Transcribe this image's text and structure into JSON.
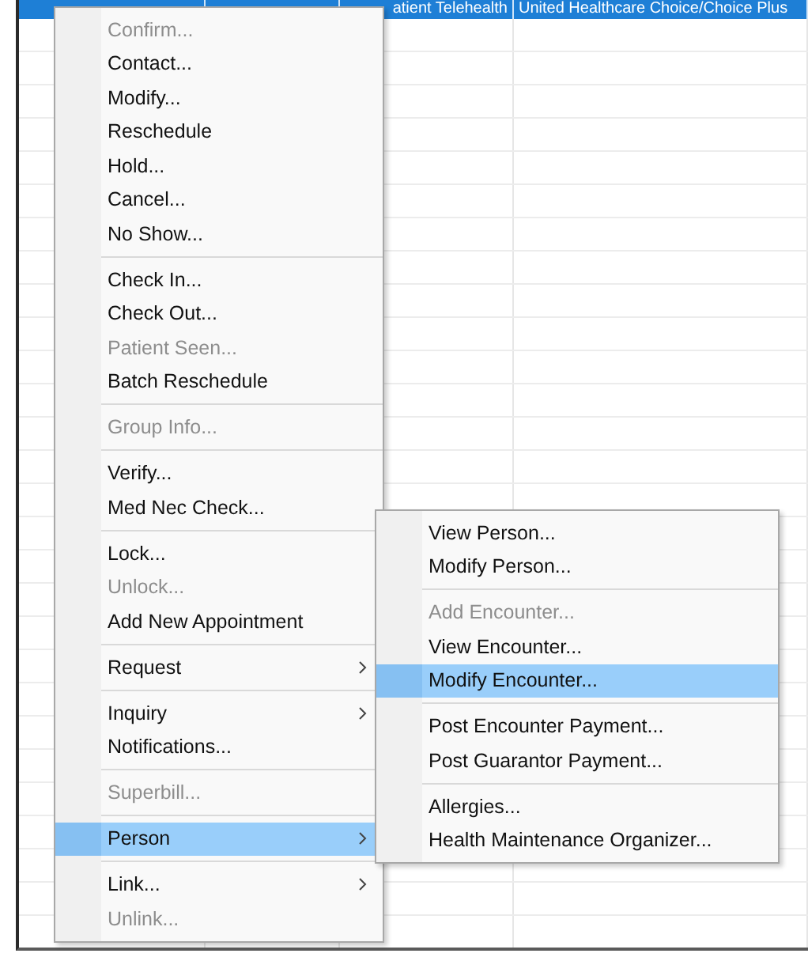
{
  "grid": {
    "selected_row": {
      "cells": [
        "atient Telehealth",
        "United Healthcare Choice/Choice Plus"
      ]
    }
  },
  "context_menu": {
    "groups": [
      [
        {
          "label": "Confirm...",
          "disabled": true,
          "selected": false,
          "has_submenu": false
        },
        {
          "label": "Contact...",
          "disabled": false,
          "selected": false,
          "has_submenu": false
        },
        {
          "label": "Modify...",
          "disabled": false,
          "selected": false,
          "has_submenu": false
        },
        {
          "label": "Reschedule",
          "disabled": false,
          "selected": false,
          "has_submenu": false
        },
        {
          "label": "Hold...",
          "disabled": false,
          "selected": false,
          "has_submenu": false
        },
        {
          "label": "Cancel...",
          "disabled": false,
          "selected": false,
          "has_submenu": false
        },
        {
          "label": "No Show...",
          "disabled": false,
          "selected": false,
          "has_submenu": false
        }
      ],
      [
        {
          "label": "Check In...",
          "disabled": false,
          "selected": false,
          "has_submenu": false
        },
        {
          "label": "Check Out...",
          "disabled": false,
          "selected": false,
          "has_submenu": false
        },
        {
          "label": "Patient Seen...",
          "disabled": true,
          "selected": false,
          "has_submenu": false
        },
        {
          "label": "Batch Reschedule",
          "disabled": false,
          "selected": false,
          "has_submenu": false
        }
      ],
      [
        {
          "label": "Group Info...",
          "disabled": true,
          "selected": false,
          "has_submenu": false
        }
      ],
      [
        {
          "label": "Verify...",
          "disabled": false,
          "selected": false,
          "has_submenu": false
        },
        {
          "label": "Med Nec Check...",
          "disabled": false,
          "selected": false,
          "has_submenu": false
        }
      ],
      [
        {
          "label": "Lock...",
          "disabled": false,
          "selected": false,
          "has_submenu": false
        },
        {
          "label": "Unlock...",
          "disabled": true,
          "selected": false,
          "has_submenu": false
        },
        {
          "label": "Add New Appointment",
          "disabled": false,
          "selected": false,
          "has_submenu": false
        }
      ],
      [
        {
          "label": "Request",
          "disabled": false,
          "selected": false,
          "has_submenu": true
        }
      ],
      [
        {
          "label": "Inquiry",
          "disabled": false,
          "selected": false,
          "has_submenu": true
        },
        {
          "label": "Notifications...",
          "disabled": false,
          "selected": false,
          "has_submenu": false
        }
      ],
      [
        {
          "label": "Superbill...",
          "disabled": true,
          "selected": false,
          "has_submenu": false
        }
      ],
      [
        {
          "label": "Person",
          "disabled": false,
          "selected": true,
          "has_submenu": true
        }
      ],
      [
        {
          "label": "Link...",
          "disabled": false,
          "selected": false,
          "has_submenu": true
        },
        {
          "label": "Unlink...",
          "disabled": true,
          "selected": false,
          "has_submenu": false
        }
      ]
    ]
  },
  "submenu": {
    "groups": [
      [
        {
          "label": "View Person...",
          "disabled": false,
          "selected": false,
          "has_submenu": false
        },
        {
          "label": "Modify Person...",
          "disabled": false,
          "selected": false,
          "has_submenu": false
        }
      ],
      [
        {
          "label": "Add Encounter...",
          "disabled": true,
          "selected": false,
          "has_submenu": false
        },
        {
          "label": "View Encounter...",
          "disabled": false,
          "selected": false,
          "has_submenu": false
        },
        {
          "label": "Modify Encounter...",
          "disabled": false,
          "selected": true,
          "has_submenu": false
        }
      ],
      [
        {
          "label": "Post Encounter Payment...",
          "disabled": false,
          "selected": false,
          "has_submenu": false
        },
        {
          "label": "Post Guarantor Payment...",
          "disabled": false,
          "selected": false,
          "has_submenu": false
        }
      ],
      [
        {
          "label": "Allergies...",
          "disabled": false,
          "selected": false,
          "has_submenu": false
        },
        {
          "label": "Health Maintenance Organizer...",
          "disabled": false,
          "selected": false,
          "has_submenu": false
        }
      ]
    ]
  }
}
